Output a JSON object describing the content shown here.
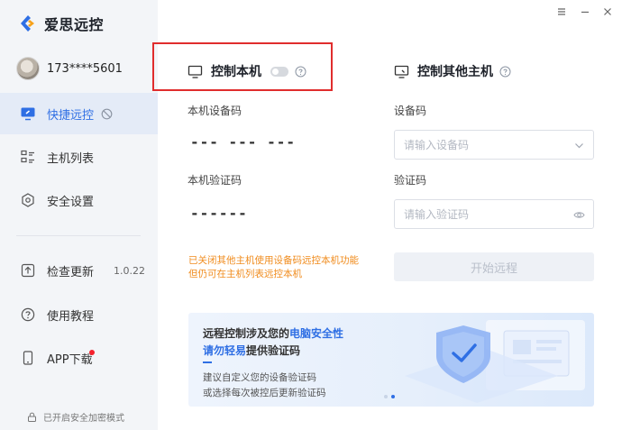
{
  "app": {
    "name": "爱思远控"
  },
  "user": {
    "phone": "173****5601"
  },
  "sidebar": {
    "items": [
      {
        "label": "快捷远控"
      },
      {
        "label": "主机列表"
      },
      {
        "label": "安全设置"
      },
      {
        "label": "检查更新",
        "version": "1.0.22"
      },
      {
        "label": "使用教程"
      },
      {
        "label": "APP下载"
      }
    ],
    "secure_mode": "已开启安全加密模式"
  },
  "local": {
    "title": "控制本机",
    "toggle_on": false,
    "device_code_label": "本机设备码",
    "device_code_value": "--- --- ---",
    "verify_code_label": "本机验证码",
    "verify_code_value": "------",
    "warning_line1": "已关闭其他主机使用设备码远控本机功能",
    "warning_line2": "但仍可在主机列表远控本机"
  },
  "remote": {
    "title": "控制其他主机",
    "device_code_label": "设备码",
    "device_code_placeholder": "请输入设备码",
    "verify_code_label": "验证码",
    "verify_code_placeholder": "请输入验证码",
    "start_button": "开始远程"
  },
  "banner": {
    "line1_a": "远程控制涉及您的",
    "line1_b": "电脑安全性",
    "line2_a": "请勿轻易",
    "line2_b": "提供验证码",
    "line3": "建议自定义您的设备验证码",
    "line4": "或选择每次被控后更新验证码"
  },
  "colors": {
    "accent": "#2f6fe4",
    "warning": "#f08c1e",
    "highlight": "#e02d2d",
    "sidebar_bg": "#f3f5f8"
  },
  "icons": [
    "logo-icon",
    "monitor-icon",
    "help-icon",
    "chevron-down-icon",
    "eye-icon",
    "lock-icon",
    "menu-icon",
    "minimize-icon",
    "close-icon"
  ]
}
